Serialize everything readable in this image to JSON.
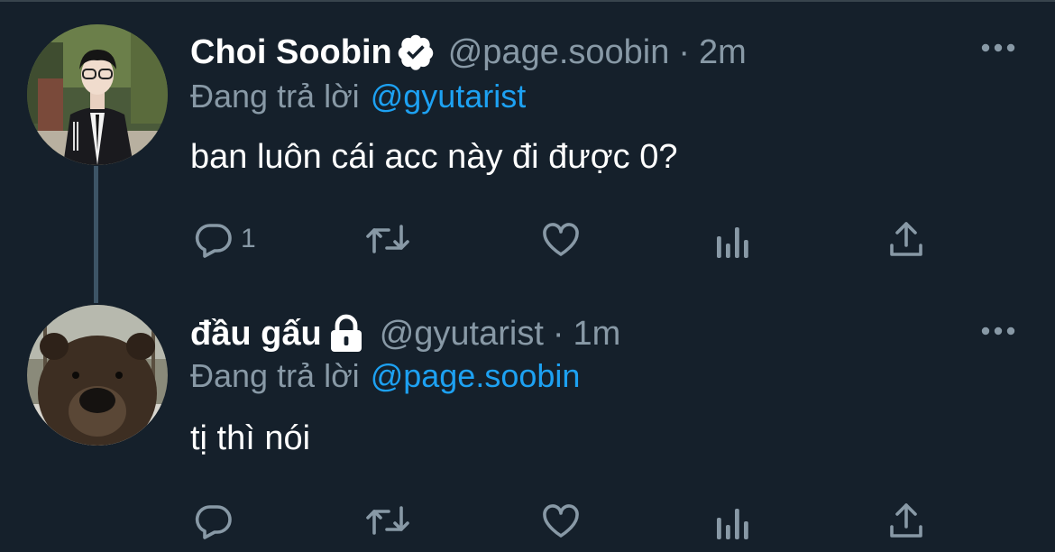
{
  "tweets": [
    {
      "author_name": "Choi Soobin",
      "verified": true,
      "handle": "@page.soobin",
      "separator": "·",
      "time": "2m",
      "reply_prefix": "Đang trả lời",
      "reply_to": "@gyutarist",
      "text": "ban luôn cái acc này đi được 0?",
      "reply_count": "1"
    },
    {
      "author_name": "đầu gấu",
      "locked": true,
      "handle": "@gyutarist",
      "separator": "·",
      "time": "1m",
      "reply_prefix": "Đang trả lời",
      "reply_to": "@page.soobin",
      "text": "tị thì nói",
      "reply_count": ""
    }
  ],
  "icons": {
    "reply": "reply-icon",
    "retweet": "retweet-icon",
    "like": "heart-icon",
    "analytics": "analytics-icon",
    "share": "share-icon",
    "more": "more-icon",
    "verified": "verified-badge-icon",
    "lock": "lock-icon"
  },
  "colors": {
    "background": "#15202b",
    "text": "#ffffff",
    "secondary": "#8899a6",
    "accent": "#1da1f2",
    "thread_line": "#3d5466"
  }
}
